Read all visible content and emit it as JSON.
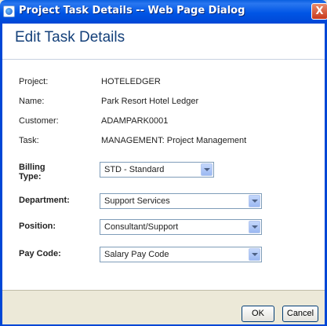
{
  "window": {
    "title": "Project Task Details -- Web Page Dialog",
    "close_label": "X"
  },
  "header": {
    "title": "Edit Task Details"
  },
  "details": {
    "project_label": "Project:",
    "project_value": "HOTELEDGER",
    "name_label": "Name:",
    "name_value": "Park Resort Hotel Ledger",
    "customer_label": "Customer:",
    "customer_value": "ADAMPARK0001",
    "task_label": "Task:",
    "task_value": "MANAGEMENT: Project Management"
  },
  "form": {
    "billing_type_label": "Billing Type:",
    "billing_type_value": "STD - Standard",
    "department_label": "Department:",
    "department_value": "Support Services",
    "position_label": "Position:",
    "position_value": "Consultant/Support",
    "pay_code_label": "Pay Code:",
    "pay_code_value": "Salary Pay Code"
  },
  "buttons": {
    "ok": "OK",
    "cancel": "Cancel"
  },
  "colors": {
    "titlebar": "#0055e5",
    "header_title": "#14407a",
    "footer": "#ece9d8"
  }
}
